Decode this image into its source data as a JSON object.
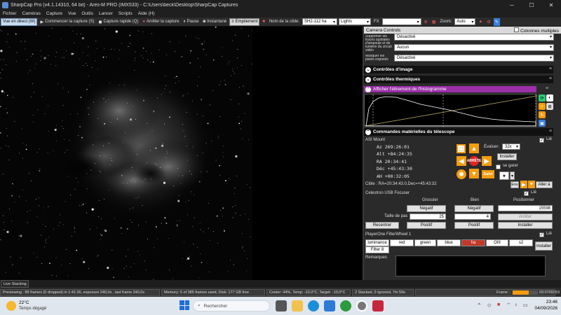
{
  "window": {
    "title": "SharpCap Pro (v4.1.14310, 64 bit) - Ares-M PRO (IMX533) - C:\\Users\\beck\\Desktop\\SharpCap Captures"
  },
  "menu": [
    "Fichier",
    "Caméras",
    "Capture",
    "Vue",
    "Outils",
    "Lancer",
    "Scripts",
    "Aide (H)"
  ],
  "toolbar": {
    "live_view": "Vue en direct (W)",
    "start_capture": "Commencer la capture (S)",
    "quick_capture": "Capture rapide (Q)",
    "stop_capture": "Arrêter la capture",
    "pause": "Pause",
    "snapshot": "Instantané",
    "stacking": "Empilement",
    "target_name_label": "Nom de la cible:",
    "target_name": "SH2-112 ha",
    "frame_type": "Lights",
    "fx_label": "FX",
    "fx_value": "",
    "zoom_label": "Zoom:",
    "zoom_value": "Auto"
  },
  "panel": {
    "header": "Camera Controls",
    "columns_option": "Colonnes multiples",
    "settings": [
      {
        "label": "Supprimer les traces spatiales d'ampoule et de lumière du circuit vidéo",
        "value": "Désactivé"
      },
      {
        "label": "Supprimer les pixels exposés",
        "value": "Aucun"
      },
      {
        "label": "Masquer les pixels exposés",
        "value": "Désactivé"
      }
    ],
    "sections": {
      "image_controls": "Contrôles d'image",
      "thermal_controls": "Contrôles thermiques",
      "histogram": "Afficher l'étirement de l'histogramme",
      "telescope": "Commandes matérielles du télescope"
    },
    "mount": {
      "name": "ASI Mount",
      "enabled_label": "Lié",
      "az": "Az   269:26:01",
      "alt": "Alt  +84:24:35",
      "ra": "RA   20:34:41",
      "dec": "Déc  +45:43:30",
      "ah": "AH   +00:32:05",
      "rate_label": "Évaluer:",
      "rate_value": "32x",
      "install": "Installer",
      "park_label": "se garer",
      "stop_label": "ARRÊTE",
      "sync_label": "Suivi",
      "target_text": "Cible : RA=20:34:43.0,Dec=+45:43:32",
      "goto_label": "Aller à"
    },
    "focuser": {
      "name": "Celestron USB Focuser",
      "enabled_label": "Lié",
      "coarse": "Grossier",
      "fine": "Bien",
      "position_label": "Positionner",
      "negative": "Négatif",
      "positive": "Positif",
      "step_label": "Taille de pas",
      "coarse_step": "25",
      "fine_step": "4",
      "position": "15598",
      "stop": "Arrêter",
      "recenter": "Recentrer",
      "install": "Installer"
    },
    "filterwheel": {
      "name": "PlayerOne FilterWheel 1",
      "enabled_label": "Lié",
      "filters": [
        "luminance",
        "red",
        "green",
        "blue",
        "ha",
        "OIII",
        "s2"
      ],
      "selected": "ha",
      "filter8": "Filter 8",
      "install": "Installer"
    },
    "notes_label": "Remarques"
  },
  "status": {
    "mode": "Live Stacking",
    "preview": "Previewing : 89 frames (0 dropped) in 1:41:26, exposure 240,0s , last frame 240,0s",
    "memory": "Memory: 5 of 385 frames used, Disk: 177 GB free",
    "cooler": "Cooler: 44%, Temp: -10,0°C, Target: -10,0°C",
    "stacked": "2 Stacked, 0 Ignored, 7m 59s",
    "frame_label": "Frame :",
    "frame_time": "03:07/00:53",
    "frame_progress": 0.63
  },
  "taskbar": {
    "weather_temp": "22°C",
    "weather_text": "Temps dégagé",
    "search_placeholder": "Rechercher",
    "time": "23:46",
    "date": "04/09/2026"
  },
  "colors": {
    "accent_orange": "#f39c12",
    "histogram_purple": "#9b30a8",
    "stop_red": "#e02424",
    "filter_selected": "#c0392b"
  }
}
